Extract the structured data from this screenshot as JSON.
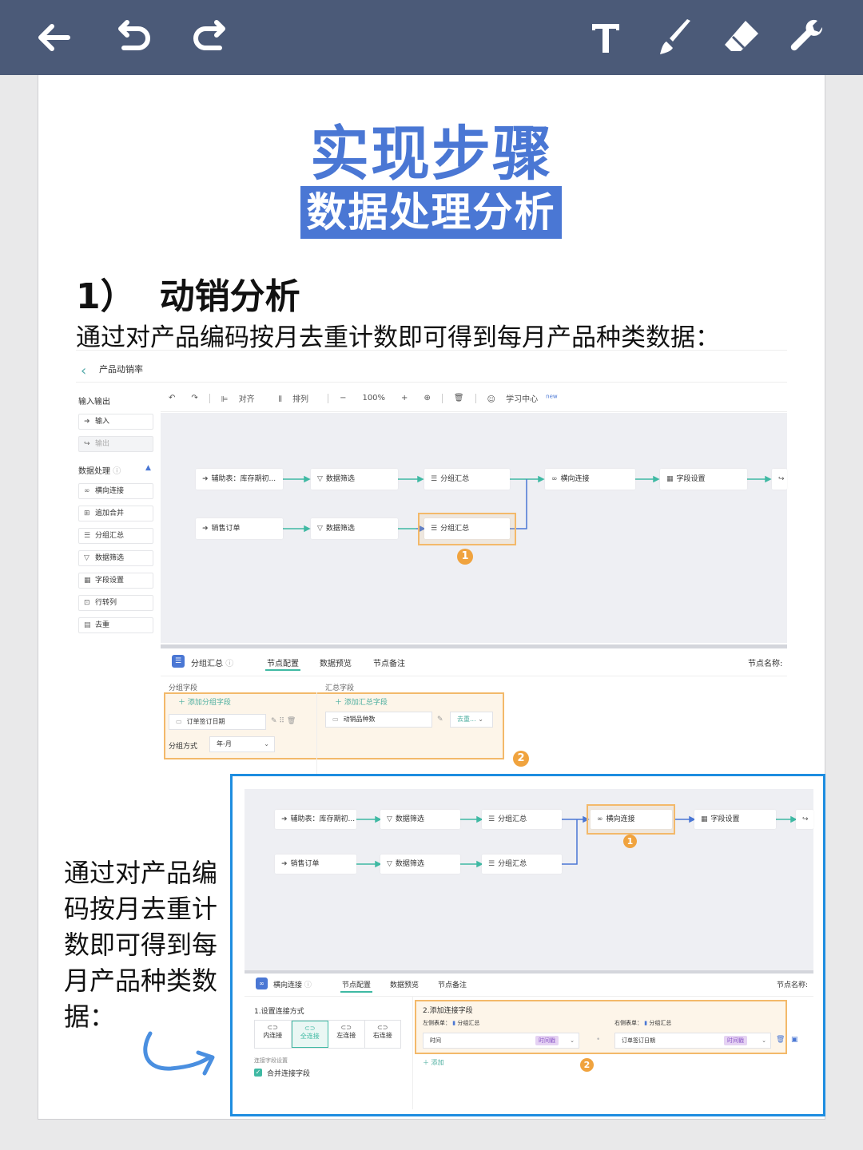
{
  "toolbar": {
    "icons": [
      "back-arrow-icon",
      "undo-icon",
      "redo-icon",
      "text-icon",
      "brush-icon",
      "eraser-icon",
      "wrench-icon"
    ]
  },
  "title": {
    "main": "实现步骤",
    "sub": "数据处理分析"
  },
  "section": {
    "number": "1）",
    "heading": "动销分析",
    "intro": "通过对产品编码按月去重计数即可得到每月产品种类数据："
  },
  "app": {
    "page_title": "产品动销率",
    "sidebar": {
      "io_header": "输入输出",
      "io_items": [
        "输入",
        "输出"
      ],
      "proc_header": "数据处理",
      "proc_items": [
        "横向连接",
        "追加合并",
        "分组汇总",
        "数据筛选",
        "字段设置",
        "行转列",
        "去重"
      ]
    },
    "tools": {
      "align": "对齐",
      "arrange": "排列",
      "zoom": "100%",
      "learn": "学习中心",
      "new_badge": "new"
    },
    "flow": {
      "row1": [
        "辅助表：库存期初...",
        "数据筛选",
        "分组汇总",
        "横向连接",
        "字段设置"
      ],
      "row2": [
        "销售订单",
        "数据筛选",
        "分组汇总"
      ]
    },
    "badges": [
      "1",
      "2"
    ],
    "panel": {
      "node_name": "分组汇总",
      "tabs": [
        "节点配置",
        "数据预览",
        "节点备注"
      ],
      "node_name_label": "节点名称:",
      "group_field_label": "分组字段",
      "add_group_field": "添加分组字段",
      "group_field_value": "订单签订日期",
      "group_mode_label": "分组方式",
      "group_mode_value": "年-月",
      "summary_label": "汇总字段",
      "add_summary_field": "添加汇总字段",
      "summary_field_value": "动销品种数",
      "summary_func": "去重..."
    }
  },
  "inset": {
    "flow": {
      "row1": [
        "辅助表：库存期初...",
        "数据筛选",
        "分组汇总",
        "横向连接",
        "字段设置"
      ],
      "row2": [
        "销售订单",
        "数据筛选",
        "分组汇总"
      ]
    },
    "panel": {
      "node_name": "横向连接",
      "tabs": [
        "节点配置",
        "数据预览",
        "节点备注"
      ],
      "node_name_label": "节点名称:",
      "join_mode_label": "1.设置连接方式",
      "join_types": [
        "内连接",
        "全连接",
        "左连接",
        "右连接"
      ],
      "join_field_settings": "连接字段设置",
      "merge_label": "合并连接字段",
      "add_join_label": "2.添加连接字段",
      "left_table_label": "左侧表单：",
      "left_table": "分组汇总",
      "right_table_label": "右侧表单：",
      "right_table": "分组汇总",
      "left_field": "时间",
      "right_field": "订单签订日期",
      "tag": "时间戳",
      "add_link": "添加"
    }
  },
  "side_text": "通过对产品编码按月去重计数即可得到每月产品种类数据：",
  "colors": {
    "toolbar_bg": "#4b5a78",
    "title_blue": "#4a77d4",
    "highlight": "#f3b96a",
    "inset_border": "#1e8de0",
    "flow_line": "#3fb9a3"
  }
}
